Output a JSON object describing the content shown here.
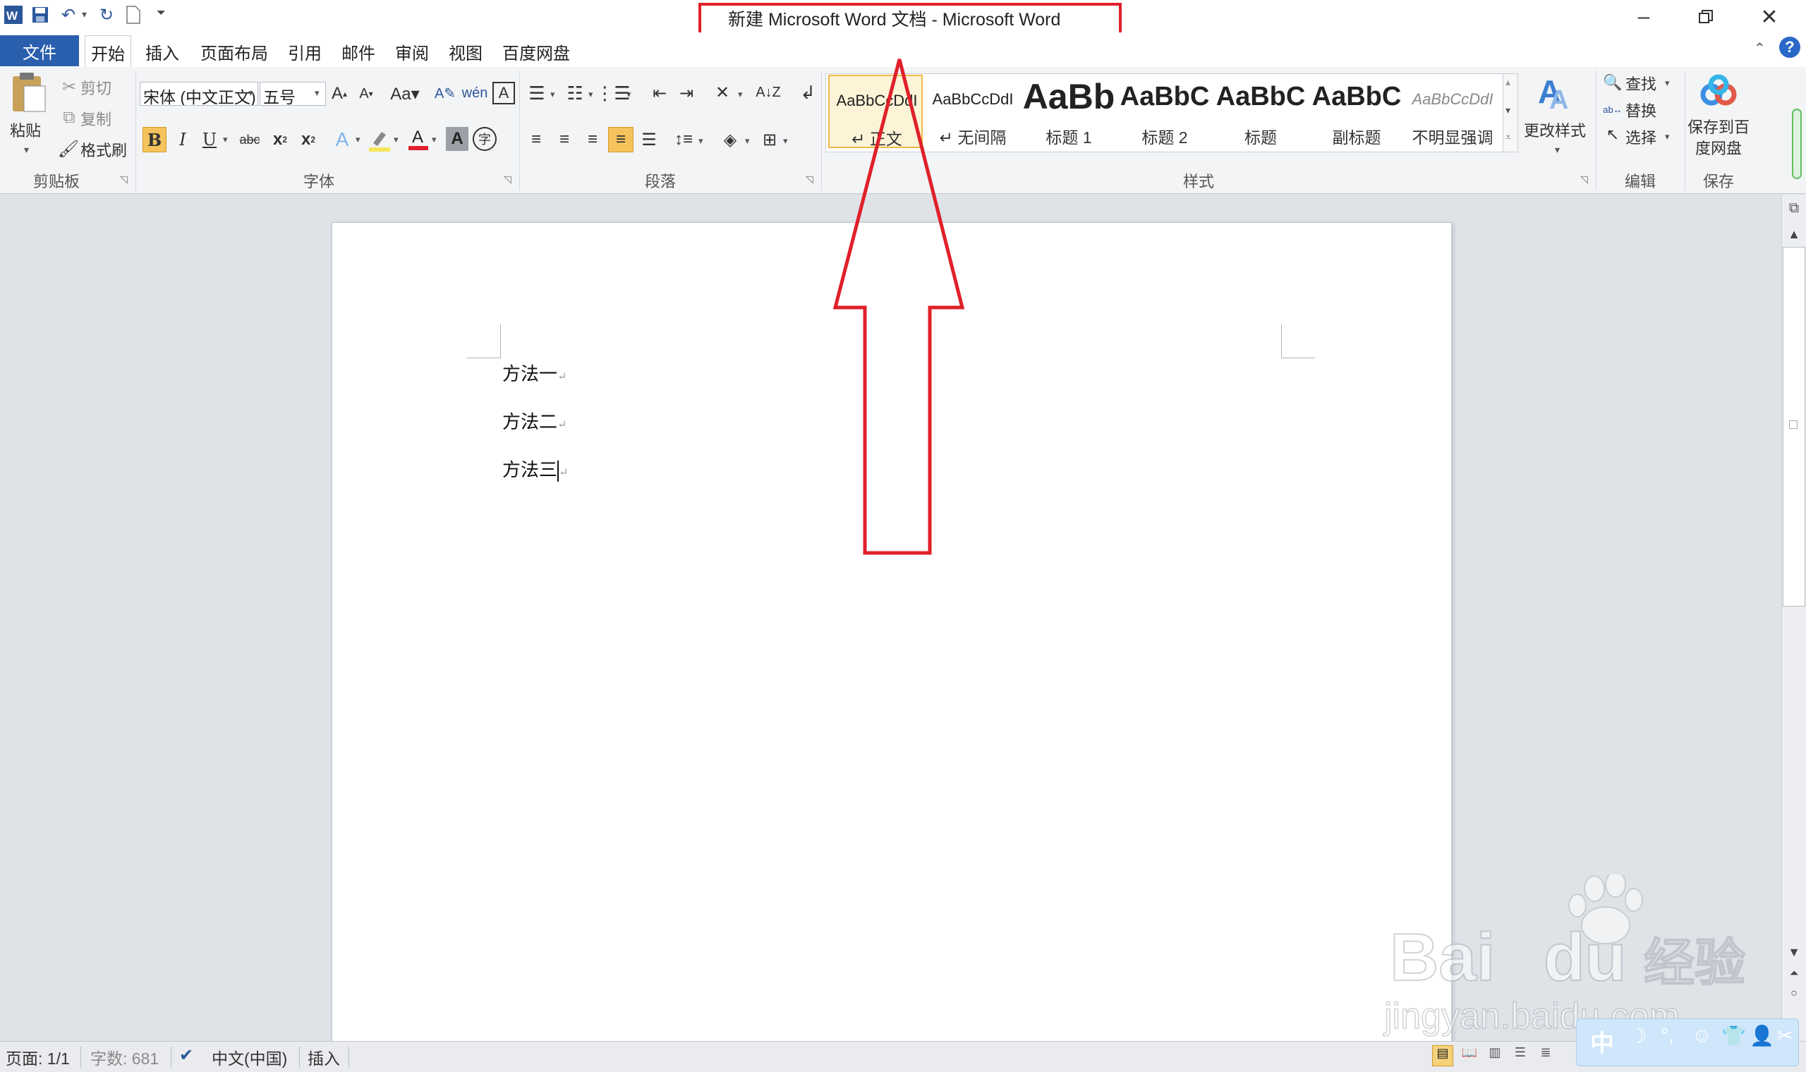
{
  "app": {
    "title": "新建 Microsoft Word 文档 - Microsoft Word",
    "quick_access": [
      "word-logo-icon",
      "save-icon",
      "undo-icon",
      "redo-icon",
      "new-document-icon"
    ]
  },
  "menu": {
    "file": "文件",
    "tabs": [
      "开始",
      "插入",
      "页面布局",
      "引用",
      "邮件",
      "审阅",
      "视图",
      "百度网盘"
    ],
    "active": "开始"
  },
  "ribbon": {
    "clipboard": {
      "paste": "粘贴",
      "cut": "剪切",
      "copy": "复制",
      "format_painter": "格式刷",
      "label": "剪贴板"
    },
    "font": {
      "name": "宋体 (中文正文)",
      "size": "五号",
      "label": "字体"
    },
    "paragraph": {
      "label": "段落"
    },
    "styles": {
      "items": [
        {
          "sample": "AaBbCcDdI",
          "name": "↵ 正文"
        },
        {
          "sample": "AaBbCcDdI",
          "name": "↵ 无间隔"
        },
        {
          "sample": "AaBb",
          "name": "标题 1"
        },
        {
          "sample": "AaBbC",
          "name": "标题 2"
        },
        {
          "sample": "AaBbC",
          "name": "标题"
        },
        {
          "sample": "AaBbC",
          "name": "副标题"
        },
        {
          "sample": "AaBbCcDdI",
          "name": "不明显强调"
        }
      ],
      "change_styles": "更改样式",
      "label": "样式"
    },
    "editing": {
      "find": "查找",
      "replace": "替换",
      "select": "选择",
      "label": "编辑"
    },
    "save_cloud": {
      "button": "保存到百度网盘",
      "line1": "保存到百",
      "line2": "度网盘",
      "label": "保存"
    }
  },
  "document": {
    "paragraphs": [
      "方法一",
      "方法二",
      "方法三"
    ]
  },
  "statusbar": {
    "page": "页面: 1/1",
    "words": "字数: 681",
    "language": "中文(中国)",
    "mode": "插入"
  },
  "watermark": {
    "brand": "Baidu经验",
    "url": "jingyan.baidu.com"
  },
  "ime": {
    "text": "中"
  },
  "colors": {
    "file_tab": "#2a5fae",
    "annotation_red": "#e0202a",
    "highlight_yellow": "#f5e65b",
    "font_red": "#e0202a"
  }
}
